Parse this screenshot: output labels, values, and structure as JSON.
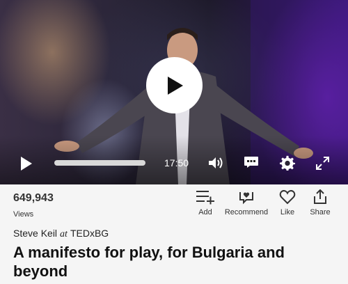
{
  "player": {
    "duration": "17:50",
    "progress_fraction": 0.0,
    "icons": {
      "big_play": "play-icon",
      "play": "play-icon",
      "volume": "volume-icon",
      "captions": "captions-icon",
      "settings": "gear-icon",
      "fullscreen": "fullscreen-icon"
    }
  },
  "stats": {
    "views_count": "649,943",
    "views_label": "Views"
  },
  "actions": [
    {
      "label": "Add",
      "icon": "playlist-add-icon"
    },
    {
      "label": "Recommend",
      "icon": "recommend-icon"
    },
    {
      "label": "Like",
      "icon": "heart-icon"
    },
    {
      "label": "Share",
      "icon": "share-icon"
    }
  ],
  "talk": {
    "speaker": "Steve Keil",
    "at": "at",
    "event": "TEDxBG",
    "title": "A manifesto for play, for Bulgaria and beyond"
  },
  "colors": {
    "page_bg": "#f5f5f5",
    "text": "#111111",
    "progress_track": "#d9d9d9"
  }
}
